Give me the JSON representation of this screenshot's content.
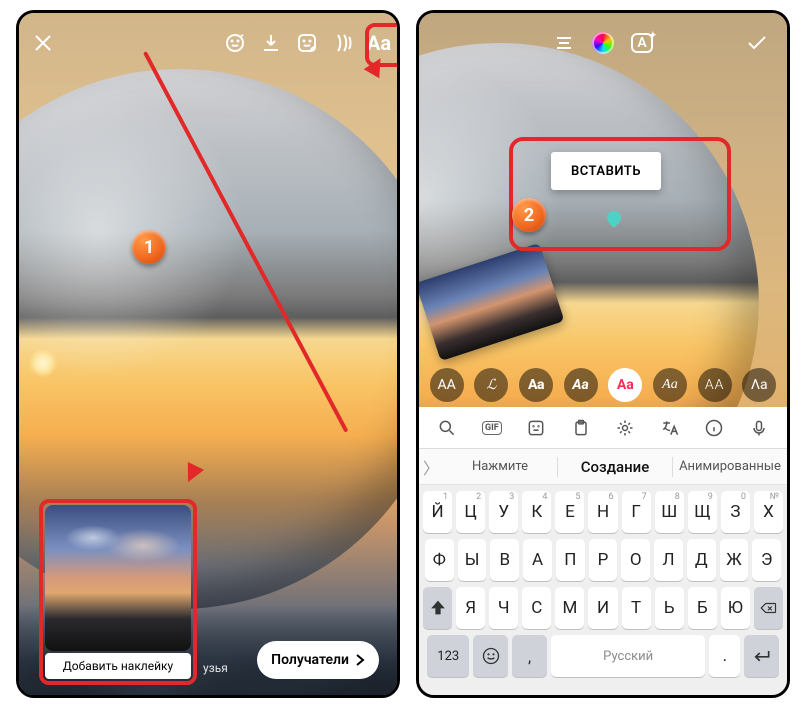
{
  "left": {
    "sticker_label": "Добавить наклейку",
    "friends_hint": "узья",
    "recipients_label": "Получатели",
    "text_tool_label": "Aa",
    "badge": "1"
  },
  "right": {
    "paste_label": "ВСТАВИТЬ",
    "badge": "2",
    "effects_label": "A",
    "font_options": [
      "AA",
      "ℒ",
      "Aa",
      "Aa",
      "Aa",
      "Aa",
      "AA",
      "Λa"
    ],
    "toolbar": {
      "gif": "GIF"
    },
    "suggestions": {
      "left": "Нажмите",
      "center": "Создание",
      "right": "Анимированные"
    },
    "keyboard": {
      "row1": [
        {
          "k": "Й",
          "s": "1"
        },
        {
          "k": "Ц",
          "s": "2"
        },
        {
          "k": "У",
          "s": "3"
        },
        {
          "k": "К",
          "s": "4"
        },
        {
          "k": "Е",
          "s": "5"
        },
        {
          "k": "Н",
          "s": "6"
        },
        {
          "k": "Г",
          "s": "7"
        },
        {
          "k": "Ш",
          "s": "8"
        },
        {
          "k": "Щ",
          "s": "9"
        },
        {
          "k": "З",
          "s": "0"
        },
        {
          "k": "Х",
          "s": "№"
        }
      ],
      "row2": [
        "Ф",
        "Ы",
        "В",
        "А",
        "П",
        "Р",
        "О",
        "Л",
        "Д",
        "Ж",
        "Э"
      ],
      "row3": [
        "Я",
        "Ч",
        "С",
        "М",
        "И",
        "Т",
        "Ь",
        "Б",
        "Ю"
      ],
      "sym": "123",
      "space": "Русский",
      "dot": "."
    }
  }
}
